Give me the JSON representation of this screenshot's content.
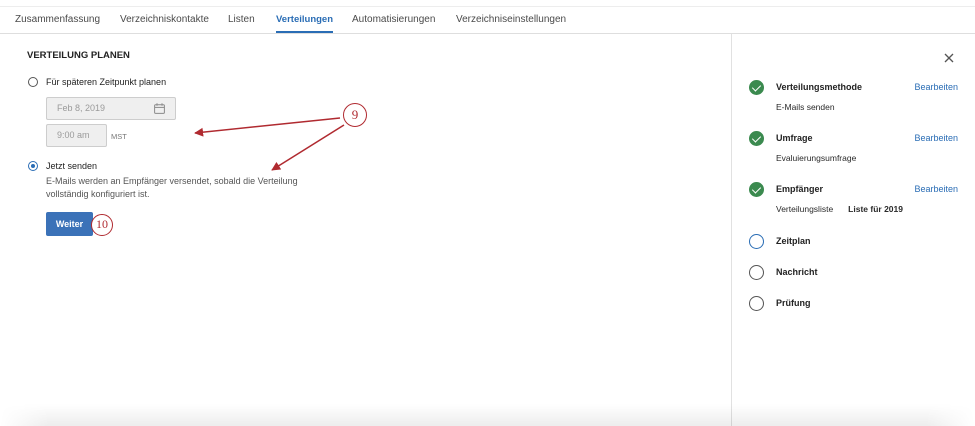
{
  "tabs": [
    {
      "label": "Zusammenfassung",
      "active": false
    },
    {
      "label": "Verzeichniskontakte",
      "active": false
    },
    {
      "label": "Listen",
      "active": false
    },
    {
      "label": "Verteilungen",
      "active": true
    },
    {
      "label": "Automatisierungen",
      "active": false
    },
    {
      "label": "Verzeichniseinstellungen",
      "active": false
    }
  ],
  "schedule": {
    "heading": "VERTEILUNG PLANEN",
    "later_option": {
      "label": "Für späteren Zeitpunkt planen",
      "selected": false
    },
    "date_value": "Feb 8, 2019",
    "date_icon": "calendar-icon",
    "time_value": "9:00 am",
    "timezone": "MST",
    "now_option": {
      "label": "Jetzt senden",
      "selected": true,
      "description": "E-Mails werden an Empfänger versendet, sobald die Verteilung vollständig konfiguriert ist."
    },
    "next_button": "Weiter"
  },
  "annotations": [
    {
      "number": "9"
    },
    {
      "number": "10"
    }
  ],
  "steps_panel": {
    "close_icon": "close-icon",
    "steps": [
      {
        "title": "Verteilungsmethode",
        "completed": true,
        "current": false,
        "icon": "check-circle-icon",
        "edit_label": "Bearbeiten",
        "detail": "E-Mails senden"
      },
      {
        "title": "Umfrage",
        "completed": true,
        "current": false,
        "icon": "check-circle-icon",
        "edit_label": "Bearbeiten",
        "detail": "Evaluierungsumfrage"
      },
      {
        "title": "Empfänger",
        "completed": true,
        "current": false,
        "icon": "check-circle-icon",
        "edit_label": "Bearbeiten",
        "detail_label": "Verteilungsliste",
        "detail_value": "Liste für 2019"
      },
      {
        "title": "Zeitplan",
        "completed": false,
        "current": true,
        "icon": "circle-outline-icon"
      },
      {
        "title": "Nachricht",
        "completed": false,
        "current": false,
        "icon": "circle-outline-icon"
      },
      {
        "title": "Prüfung",
        "completed": false,
        "current": false,
        "icon": "circle-outline-icon"
      }
    ]
  },
  "colors": {
    "accent_blue": "#2a6db5",
    "button_blue": "#3b72b8",
    "complete_green": "#3b8a4f",
    "annotation_red": "#b02a30",
    "text_dark": "#222222",
    "divider": "#e1e1e1"
  }
}
